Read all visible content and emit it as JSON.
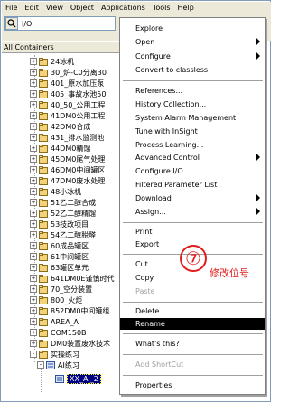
{
  "menubar": {
    "items": [
      "File",
      "Edit",
      "View",
      "Object",
      "Applications",
      "Tools",
      "Help"
    ]
  },
  "search": {
    "value": "I/O"
  },
  "tree_header": {
    "label": "All Containers"
  },
  "tree": {
    "items": [
      "24冰机",
      "30_炉-C0分离30",
      "401_原水加压泵",
      "405_事故水池50",
      "40_50_公用工程",
      "41DM0公用工程",
      "42DM0合成",
      "431_排水监测池",
      "44DM0精馏",
      "45DM0尾气处理",
      "46DM0中间罐区",
      "47DM0废水处理",
      "48小冰机",
      "51乙二醇合成",
      "52乙二醇精馏",
      "53技改项目",
      "54乙二醇脱醛",
      "60成品罐区",
      "61中间罐区",
      "63罐区单元",
      "641DM0E谨慎时代",
      "70_空分装置",
      "800_火炬",
      "852DM0中间罐组",
      "AREA_A",
      "COM150B",
      "DM0装置废水技术",
      "实操练习",
      "AI练习",
      "XX_AI_2"
    ],
    "selected": "XX_AI_2"
  },
  "context_menu": {
    "items": [
      {
        "label": "Explore",
        "submenu": false,
        "disabled": false
      },
      {
        "label": "Open",
        "submenu": true,
        "disabled": false
      },
      {
        "label": "Configure",
        "submenu": true,
        "disabled": false
      },
      {
        "label": "Convert to classless",
        "submenu": false,
        "disabled": false
      },
      {
        "label": "References...",
        "submenu": false,
        "disabled": false
      },
      {
        "label": "History Collection...",
        "submenu": false,
        "disabled": false
      },
      {
        "label": "System Alarm Management",
        "submenu": false,
        "disabled": false
      },
      {
        "label": "Tune with InSight",
        "submenu": false,
        "disabled": false
      },
      {
        "label": "Process Learning...",
        "submenu": false,
        "disabled": false
      },
      {
        "label": "Advanced Control",
        "submenu": true,
        "disabled": false
      },
      {
        "label": "Configure I/O",
        "submenu": false,
        "disabled": false
      },
      {
        "label": "Filtered Parameter List",
        "submenu": false,
        "disabled": false
      },
      {
        "label": "Download",
        "submenu": true,
        "disabled": false
      },
      {
        "label": "Assign...",
        "submenu": true,
        "disabled": false
      },
      {
        "label": "Print",
        "submenu": false,
        "disabled": false
      },
      {
        "label": "Export",
        "submenu": false,
        "disabled": false
      },
      {
        "label": "Cut",
        "submenu": false,
        "disabled": false
      },
      {
        "label": "Copy",
        "submenu": false,
        "disabled": false
      },
      {
        "label": "Paste",
        "submenu": false,
        "disabled": true
      },
      {
        "label": "Delete",
        "submenu": false,
        "disabled": false
      },
      {
        "label": "Rename",
        "submenu": false,
        "disabled": false
      },
      {
        "label": "What's this?",
        "submenu": false,
        "disabled": false
      },
      {
        "label": "Add ShortCut",
        "submenu": false,
        "disabled": true
      },
      {
        "label": "Properties",
        "submenu": false,
        "disabled": false
      }
    ],
    "highlighted": "Rename"
  },
  "annotation": {
    "number": "⑦",
    "text": "修改位号"
  },
  "colors": {
    "menubar": "#ece9d8",
    "highlight": "#000000",
    "annotation": "#e41b1b",
    "selection": "#000080"
  }
}
